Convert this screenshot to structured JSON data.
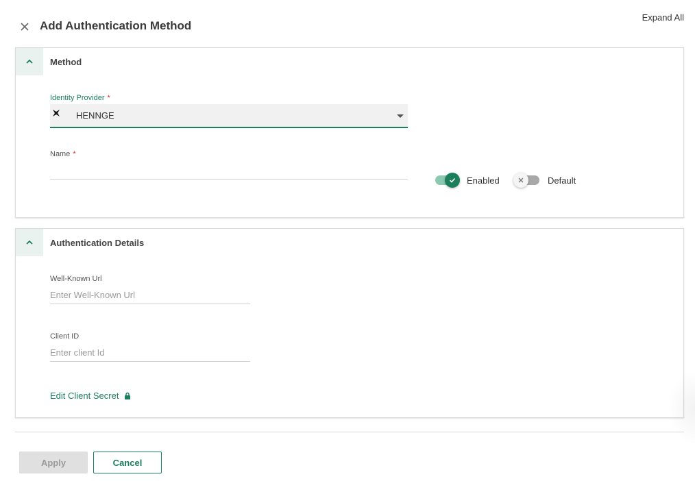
{
  "header": {
    "title": "Add Authentication Method",
    "expand_all": "Expand All",
    "close_icon": "close-icon"
  },
  "method_section": {
    "title": "Method",
    "toggle_icon": "chevron-up-icon",
    "identity_provider": {
      "label": "Identity Provider",
      "required_mark": "*",
      "value": "HENNGE",
      "icon": "henngeicon"
    },
    "name_field": {
      "label": "Name",
      "required_mark": "*",
      "value": "",
      "placeholder": ""
    },
    "enabled_toggle": {
      "label": "Enabled",
      "on": true
    },
    "default_toggle": {
      "label": "Default",
      "on": false
    }
  },
  "auth_section": {
    "title": "Authentication Details",
    "toggle_icon": "chevron-up-icon",
    "well_known_url": {
      "label": "Well-Known Url",
      "placeholder": "Enter Well-Known Url",
      "value": ""
    },
    "client_id": {
      "label": "Client ID",
      "placeholder": "Enter client Id",
      "value": ""
    },
    "edit_client_secret": "Edit Client Secret",
    "lock_icon": "lock-icon"
  },
  "footer": {
    "apply_label": "Apply",
    "cancel_label": "Cancel"
  },
  "colors": {
    "accent": "#1a7f5a",
    "accent_light": "#e9f2ee",
    "required": "#d32f2f",
    "disabled_bg": "#e0e0e0"
  }
}
